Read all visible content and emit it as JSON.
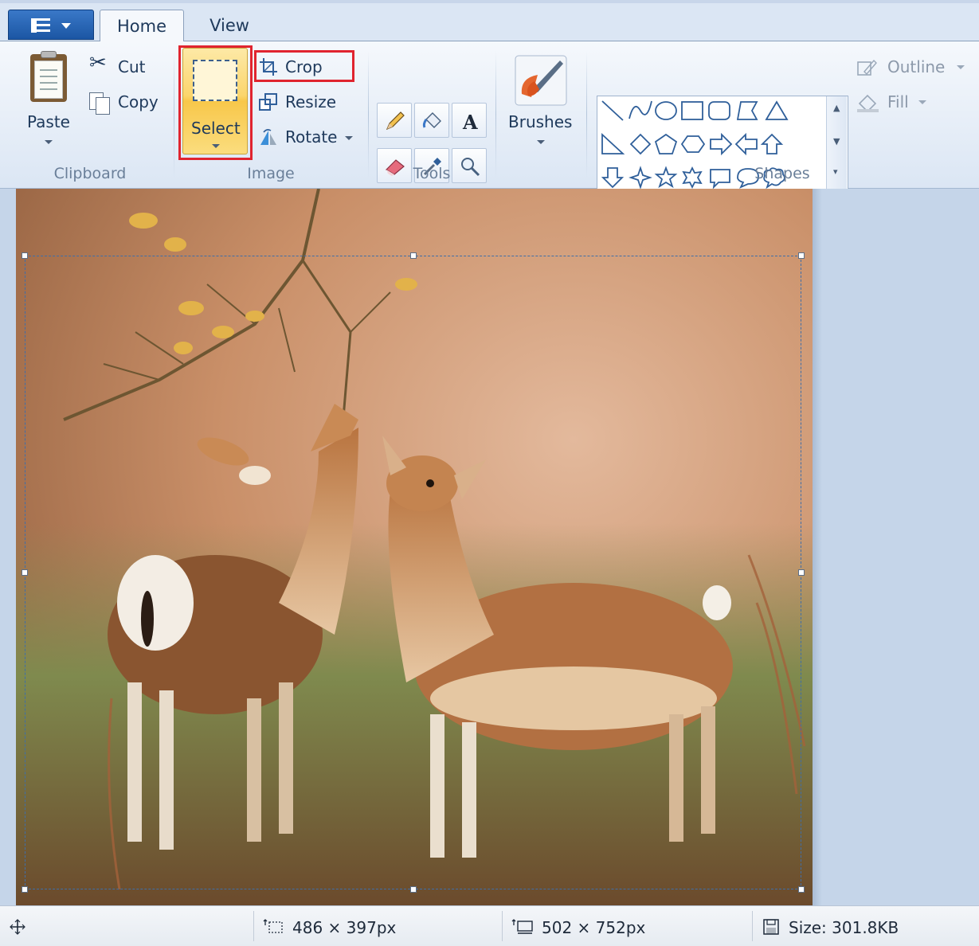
{
  "tabs": {
    "app_menu": "app-menu",
    "home": "Home",
    "view": "View"
  },
  "clipboard": {
    "paste": "Paste",
    "cut": "Cut",
    "copy": "Copy",
    "group": "Clipboard"
  },
  "image": {
    "select": "Select",
    "crop": "Crop",
    "resize": "Resize",
    "rotate": "Rotate",
    "group": "Image"
  },
  "tools": {
    "group": "Tools",
    "items": [
      "pencil-icon",
      "fill-bucket-icon",
      "text-icon",
      "eraser-icon",
      "color-picker-icon",
      "magnifier-icon"
    ]
  },
  "brushes": {
    "label": "Brushes"
  },
  "shapes": {
    "group": "Shapes",
    "outline": "Outline",
    "fill": "Fill"
  },
  "status": {
    "selection_size": "486 × 397px",
    "image_size": "502 × 752px",
    "file_size": "Size: 301.8KB"
  },
  "colors": {
    "selected_button": "#fbd56c",
    "highlight_box": "#e0242f",
    "ribbon_bg": "#dbe6f4"
  }
}
